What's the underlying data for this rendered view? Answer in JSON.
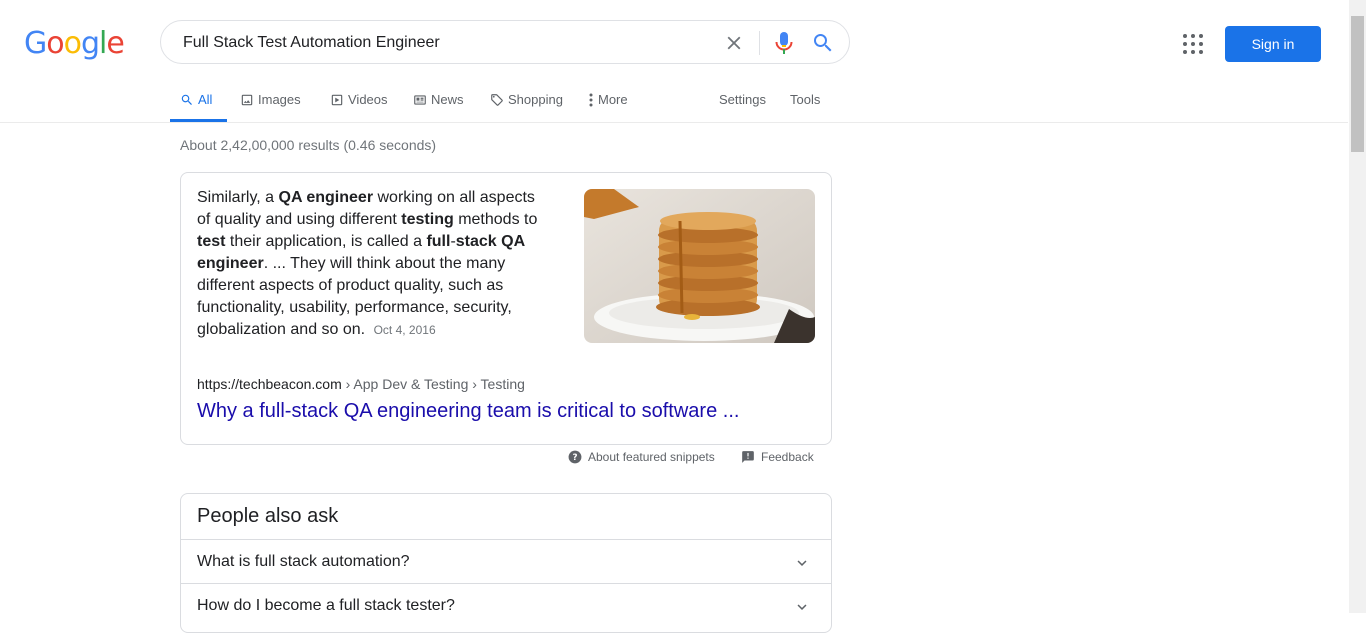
{
  "logo": [
    "G",
    "o",
    "o",
    "g",
    "l",
    "e"
  ],
  "logo_colors": [
    "#4285F4",
    "#EA4335",
    "#FBBC05",
    "#4285F4",
    "#34A853",
    "#EA4335"
  ],
  "search": {
    "value": "Full Stack Test Automation Engineer"
  },
  "header": {
    "signin_label": "Sign in"
  },
  "tabs": {
    "all": "All",
    "images": "Images",
    "videos": "Videos",
    "news": "News",
    "shopping": "Shopping",
    "more": "More",
    "settings": "Settings",
    "tools": "Tools"
  },
  "result_stats": "About 2,42,00,000 results (0.46 seconds)",
  "snippet": {
    "segments": [
      {
        "t": "Similarly, a ",
        "b": false
      },
      {
        "t": "QA engineer",
        "b": true
      },
      {
        "t": " working on all aspects of quality and using different ",
        "b": false
      },
      {
        "t": "testing",
        "b": true
      },
      {
        "t": " methods to ",
        "b": false
      },
      {
        "t": "test",
        "b": true
      },
      {
        "t": " their application, is called a ",
        "b": false
      },
      {
        "t": "full",
        "b": true
      },
      {
        "t": "-",
        "b": false
      },
      {
        "t": "stack",
        "b": true
      },
      {
        "t": " ",
        "b": false
      },
      {
        "t": "QA engineer",
        "b": true
      },
      {
        "t": ". ... They will think about the many different aspects of product quality, such as functionality, usability, performance, security, globalization and so on.",
        "b": false
      }
    ],
    "date": "Oct 4, 2016",
    "image_alt": "stack of pancakes with syrup",
    "cite_domain": "https://techbeacon.com",
    "cite_path": " › App Dev & Testing › Testing",
    "link_title": "Why a full-stack QA engineering team is critical to software ...",
    "about_label": "About featured snippets",
    "feedback_label": "Feedback"
  },
  "people_also_ask": {
    "title": "People also ask",
    "questions": [
      "What is full stack automation?",
      "How do I become a full stack tester?"
    ]
  },
  "icons": {
    "clear": "close-icon",
    "mic": "microphone-icon",
    "search": "search-icon",
    "apps": "apps-grid-icon",
    "help": "help-circle-icon",
    "feedback": "feedback-icon",
    "chevron": "chevron-down-icon"
  },
  "colors": {
    "accent": "#1a73e8",
    "link": "#1a0dab",
    "muted": "#70757a"
  }
}
